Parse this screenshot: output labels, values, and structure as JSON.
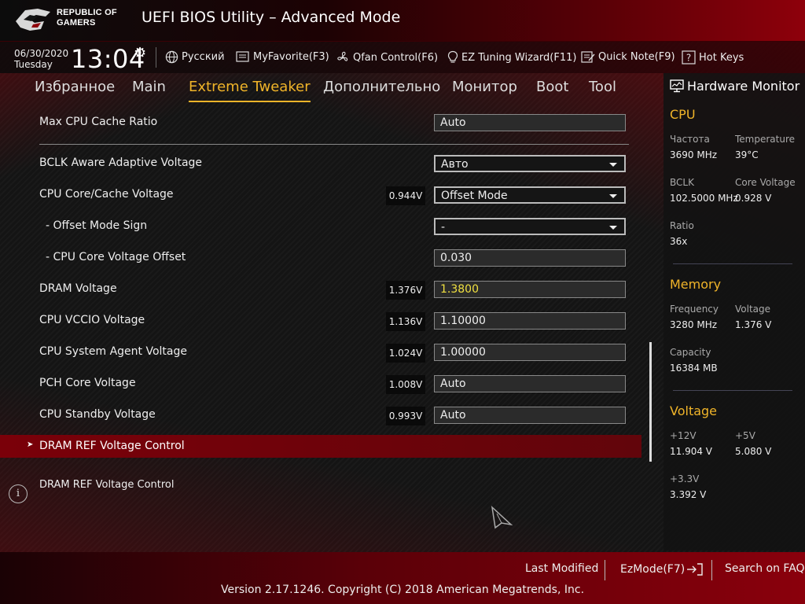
{
  "header": {
    "brand_line1": "REPUBLIC OF",
    "brand_line2": "GAMERS",
    "title": "UEFI BIOS Utility – Advanced Mode"
  },
  "infobar": {
    "date": "06/30/2020",
    "day": "Tuesday",
    "time": "13:04",
    "tools": [
      {
        "label": "Русский",
        "icon": "globe-icon"
      },
      {
        "label": "MyFavorite(F3)",
        "icon": "favorite-icon"
      },
      {
        "label": "Qfan Control(F6)",
        "icon": "fan-icon"
      },
      {
        "label": "EZ Tuning Wizard(F11)",
        "icon": "lightbulb-icon"
      },
      {
        "label": "Quick Note(F9)",
        "icon": "note-icon"
      },
      {
        "label": "Hot Keys",
        "icon": "hotkeys-icon"
      }
    ]
  },
  "menu": {
    "items": [
      "Избранное",
      "Main",
      "Extreme Tweaker",
      "Дополнительно",
      "Монитор",
      "Boot",
      "Tool"
    ],
    "active": "Extreme Tweaker"
  },
  "settings": {
    "max_cpu_cache_ratio": {
      "label": "Max CPU Cache Ratio",
      "value": "Auto"
    },
    "bclk_aware": {
      "label": "BCLK Aware Adaptive Voltage",
      "value": "Авто"
    },
    "cpu_core_cache_voltage": {
      "label": "CPU Core/Cache Voltage",
      "reading": "0.944V",
      "value": "Offset Mode"
    },
    "offset_mode_sign": {
      "label": "- Offset Mode Sign",
      "value": "-"
    },
    "cpu_core_voltage_offset": {
      "label": "- CPU Core Voltage Offset",
      "value": "0.030"
    },
    "dram_voltage": {
      "label": "DRAM Voltage",
      "reading": "1.376V",
      "value": "1.3800"
    },
    "cpu_vccio_voltage": {
      "label": "CPU VCCIO Voltage",
      "reading": "1.136V",
      "value": "1.10000"
    },
    "cpu_system_agent_voltage": {
      "label": "CPU System Agent Voltage",
      "reading": "1.024V",
      "value": "1.00000"
    },
    "pch_core_voltage": {
      "label": "PCH Core Voltage",
      "reading": "1.008V",
      "value": "Auto"
    },
    "cpu_standby_voltage": {
      "label": "CPU Standby Voltage",
      "reading": "0.993V",
      "value": "Auto"
    },
    "dram_ref_voltage_control": {
      "label": "DRAM REF Voltage Control"
    }
  },
  "help": {
    "text": "DRAM REF Voltage Control"
  },
  "hardware_monitor": {
    "title": "Hardware Monitor",
    "cpu": {
      "heading": "CPU",
      "frequency_label": "Частота",
      "frequency": "3690 MHz",
      "temperature_label": "Temperature",
      "temperature": "39°C",
      "bclk_label": "BCLK",
      "bclk": "102.5000 MHz",
      "core_voltage_label": "Core Voltage",
      "core_voltage": "0.928 V",
      "ratio_label": "Ratio",
      "ratio": "36x"
    },
    "memory": {
      "heading": "Memory",
      "frequency_label": "Frequency",
      "frequency": "3280 MHz",
      "voltage_label": "Voltage",
      "voltage": "1.376 V",
      "capacity_label": "Capacity",
      "capacity": "16384 MB"
    },
    "voltage": {
      "heading": "Voltage",
      "v12_label": "+12V",
      "v12": "11.904 V",
      "v5_label": "+5V",
      "v5": "5.080 V",
      "v33_label": "+3.3V",
      "v33": "3.392 V"
    }
  },
  "footer": {
    "last_modified": "Last Modified",
    "ezmode": "EzMode(F7)",
    "search_faq": "Search on FAQ",
    "version": "Version 2.17.1246. Copyright (C) 2018 American Megatrends, Inc."
  },
  "colors": {
    "accent": "#f0b429",
    "selection": "#7a0009",
    "highlight_value": "#f0e040"
  }
}
